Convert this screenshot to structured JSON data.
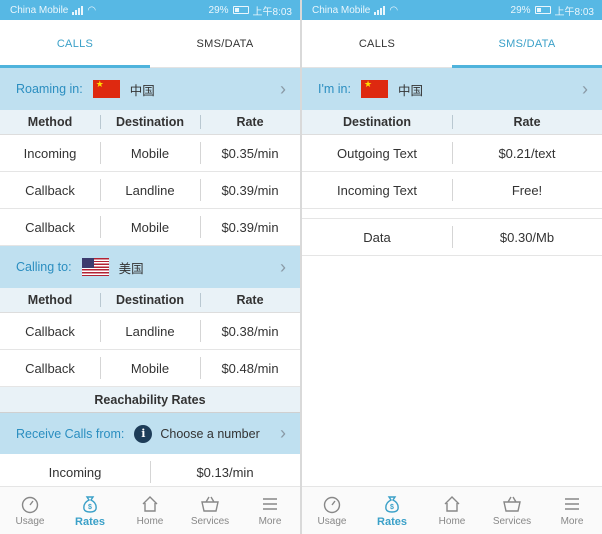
{
  "status": {
    "carrier": "China Mobile",
    "battery": "29%",
    "time": "上午8:03"
  },
  "tabs": {
    "calls": "CALLS",
    "sms": "SMS/DATA"
  },
  "left": {
    "roaming": {
      "label": "Roaming in:",
      "country": "中国",
      "flag": "china-flag"
    },
    "calls_header": {
      "method": "Method",
      "destination": "Destination",
      "rate": "Rate"
    },
    "roaming_rows": [
      {
        "method": "Incoming",
        "destination": "Mobile",
        "rate": "$0.35/min"
      },
      {
        "method": "Callback",
        "destination": "Landline",
        "rate": "$0.39/min"
      },
      {
        "method": "Callback",
        "destination": "Mobile",
        "rate": "$0.39/min"
      }
    ],
    "calling": {
      "label": "Calling to:",
      "country": "美国",
      "flag": "usa-flag"
    },
    "calling_rows": [
      {
        "method": "Callback",
        "destination": "Landline",
        "rate": "$0.38/min"
      },
      {
        "method": "Callback",
        "destination": "Mobile",
        "rate": "$0.48/min"
      }
    ],
    "reachability_title": "Reachability Rates",
    "receive": {
      "label": "Receive Calls from:",
      "placeholder": "Choose a number"
    },
    "receive_rows": [
      {
        "type": "Incoming",
        "rate": "$0.13/min"
      }
    ]
  },
  "right": {
    "im_in": {
      "label": "I'm in:",
      "country": "中国",
      "flag": "china-flag"
    },
    "header": {
      "destination": "Destination",
      "rate": "Rate"
    },
    "rows": [
      {
        "destination": "Outgoing Text",
        "rate": "$0.21/text"
      },
      {
        "destination": "Incoming Text",
        "rate": "Free!"
      }
    ],
    "data_row": {
      "destination": "Data",
      "rate": "$0.30/Mb"
    }
  },
  "nav": {
    "usage": "Usage",
    "rates": "Rates",
    "home": "Home",
    "services": "Services",
    "more": "More"
  },
  "colors": {
    "accent": "#3aa0c8",
    "status_bar": "#57b8e4",
    "section_bg": "#bfe0f0",
    "header_bg": "#e9f2f7"
  }
}
